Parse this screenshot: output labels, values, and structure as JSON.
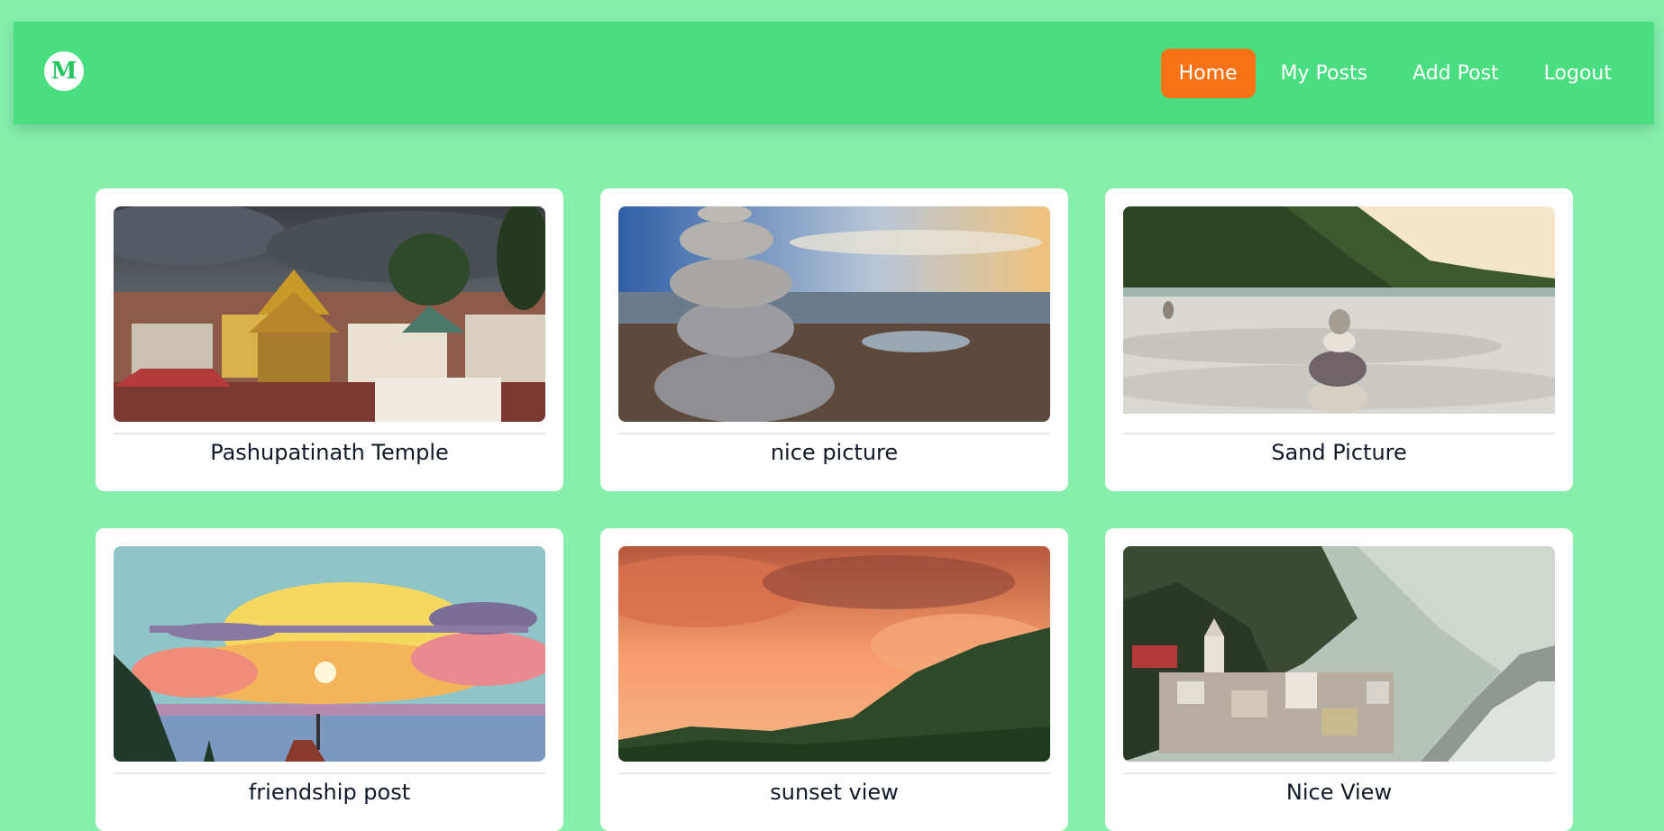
{
  "navbar": {
    "logo": "M",
    "links": [
      {
        "label": "Home",
        "active": true
      },
      {
        "label": "My Posts",
        "active": false
      },
      {
        "label": "Add Post",
        "active": false
      },
      {
        "label": "Logout",
        "active": false
      }
    ]
  },
  "posts": [
    {
      "title": "Pashupatinath Temple",
      "image": "temple-photo"
    },
    {
      "title": "nice picture",
      "image": "stacked-stones-photo"
    },
    {
      "title": "Sand Picture",
      "image": "sand-cairn-photo"
    },
    {
      "title": "friendship post",
      "image": "sunset-illustration"
    },
    {
      "title": "sunset view",
      "image": "orange-sky-photo"
    },
    {
      "title": "Nice View",
      "image": "valley-town-photo"
    }
  ],
  "colors": {
    "page_bg": "#86efac",
    "navbar_bg": "#4ade80",
    "active_link_bg": "#f97316",
    "card_bg": "#ffffff"
  }
}
